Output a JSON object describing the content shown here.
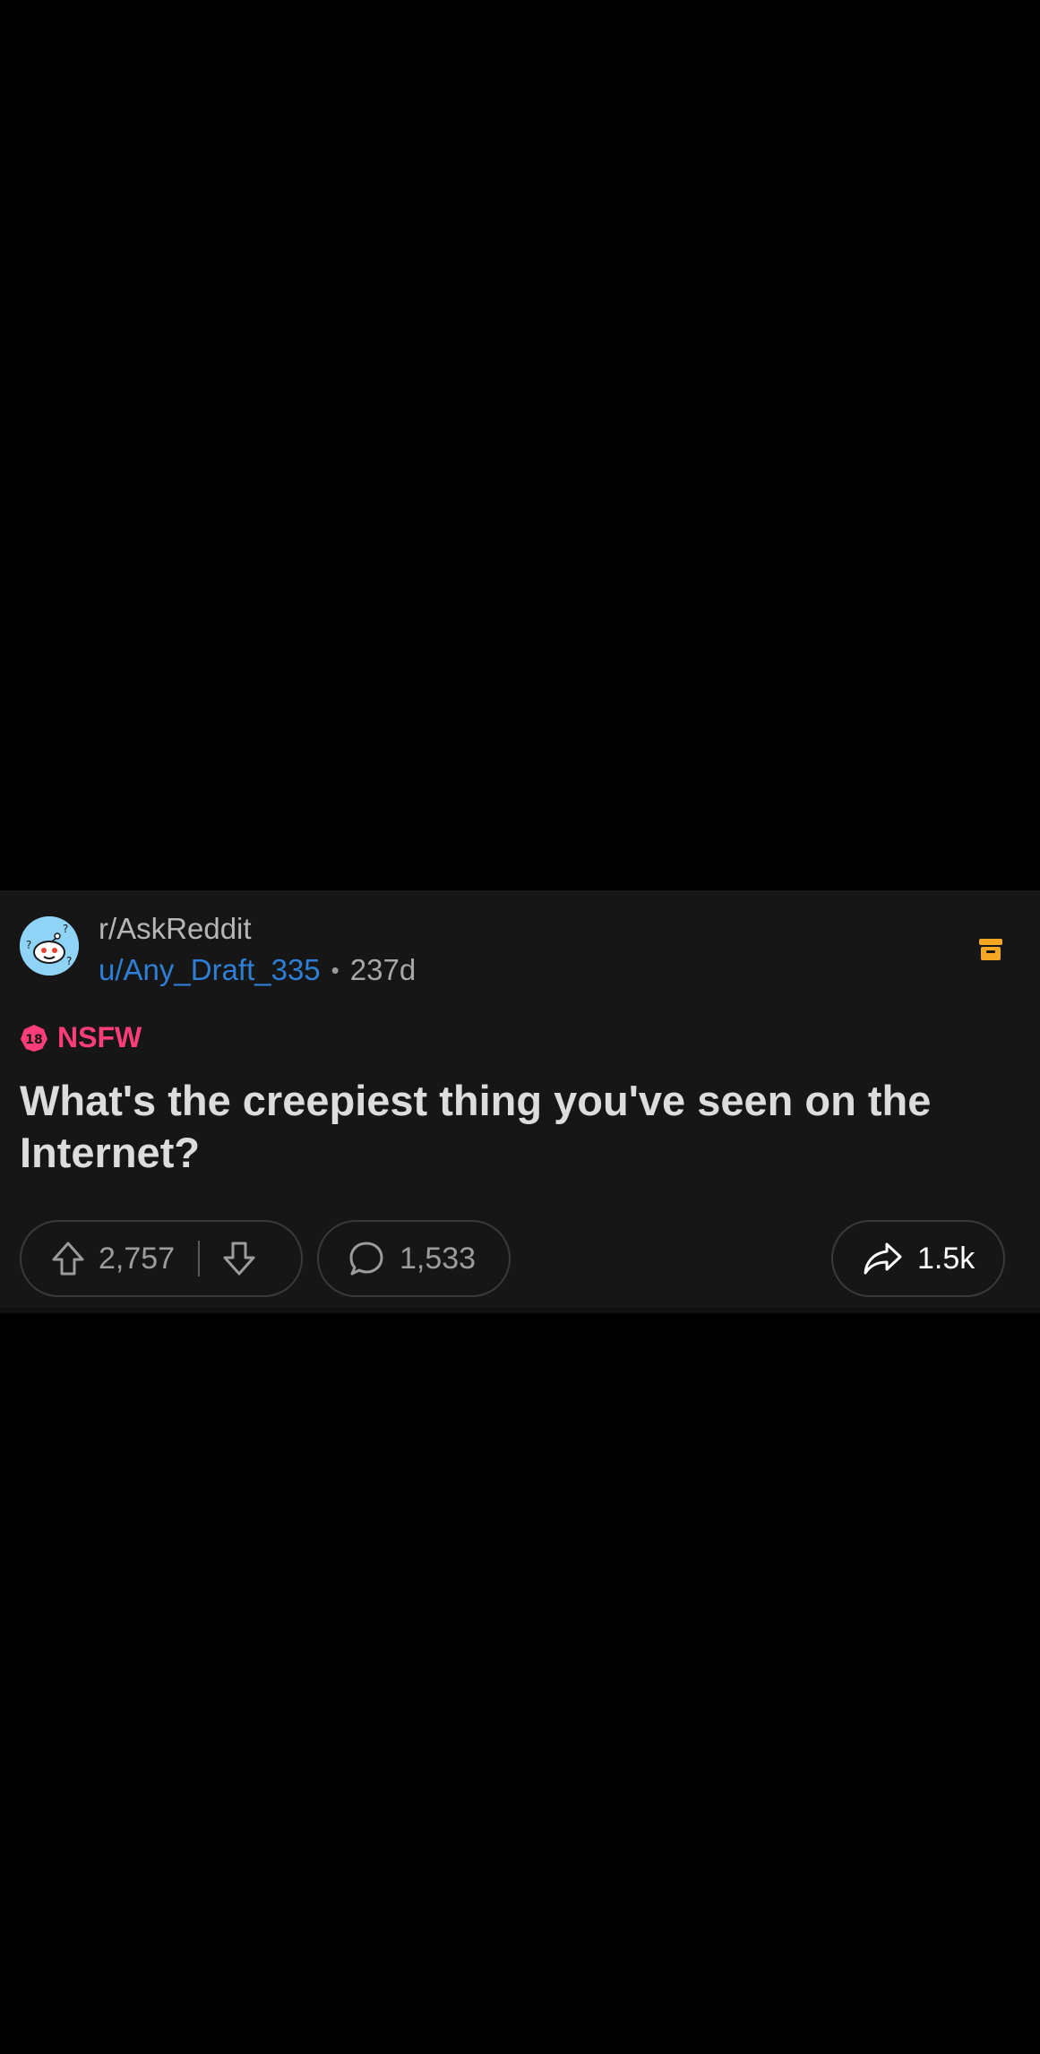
{
  "post": {
    "subreddit": "r/AskReddit",
    "username": "u/Any_Draft_335",
    "separator": "•",
    "age": "237d",
    "nsfw_badge_number": "18",
    "nsfw_label": "NSFW",
    "title": "What's the creepiest thing you've seen on the Internet?",
    "score": "2,757",
    "comments": "1,533",
    "shares": "1.5k"
  },
  "colors": {
    "background": "#000000",
    "card": "#161616",
    "username": "#2f7fd6",
    "nsfw": "#ff3d7a",
    "archive": "#f5a623"
  },
  "icons": [
    "avatar-icon",
    "archive-icon",
    "nsfw-badge-icon",
    "upvote-icon",
    "downvote-icon",
    "comment-icon",
    "share-icon"
  ]
}
